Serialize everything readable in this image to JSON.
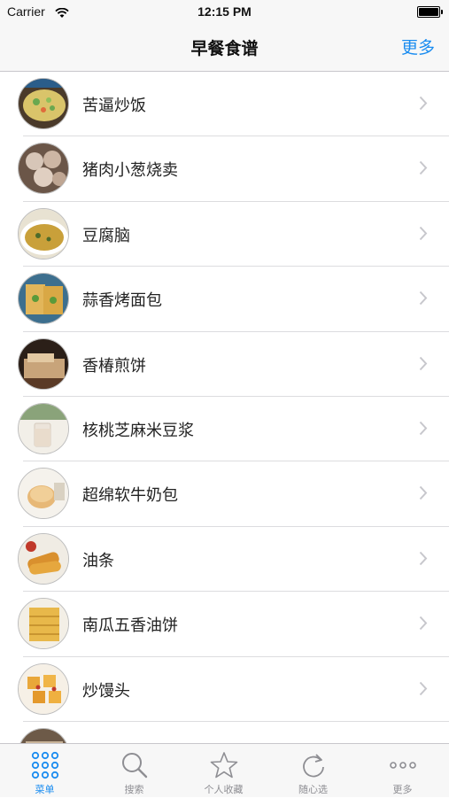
{
  "status_bar": {
    "carrier": "Carrier",
    "time": "12:15 PM"
  },
  "nav": {
    "title": "早餐食谱",
    "more": "更多"
  },
  "recipes": [
    {
      "name": "苦逼炒饭"
    },
    {
      "name": "猪肉小葱烧卖"
    },
    {
      "name": "豆腐脑"
    },
    {
      "name": "蒜香烤面包"
    },
    {
      "name": "香椿煎饼"
    },
    {
      "name": "核桃芝麻米豆浆"
    },
    {
      "name": "超绵软牛奶包"
    },
    {
      "name": "油条"
    },
    {
      "name": "南瓜五香油饼"
    },
    {
      "name": "炒馒头"
    }
  ],
  "tabs": [
    {
      "label": "菜单",
      "icon": "grid-dots-icon",
      "active": true
    },
    {
      "label": "搜索",
      "icon": "search-icon"
    },
    {
      "label": "个人收藏",
      "icon": "star-icon"
    },
    {
      "label": "随心选",
      "icon": "refresh-icon"
    },
    {
      "label": "更多",
      "icon": "more-dots-icon"
    }
  ],
  "colors": {
    "accent": "#1a8cf0",
    "tab_inactive": "#8e8e93"
  }
}
